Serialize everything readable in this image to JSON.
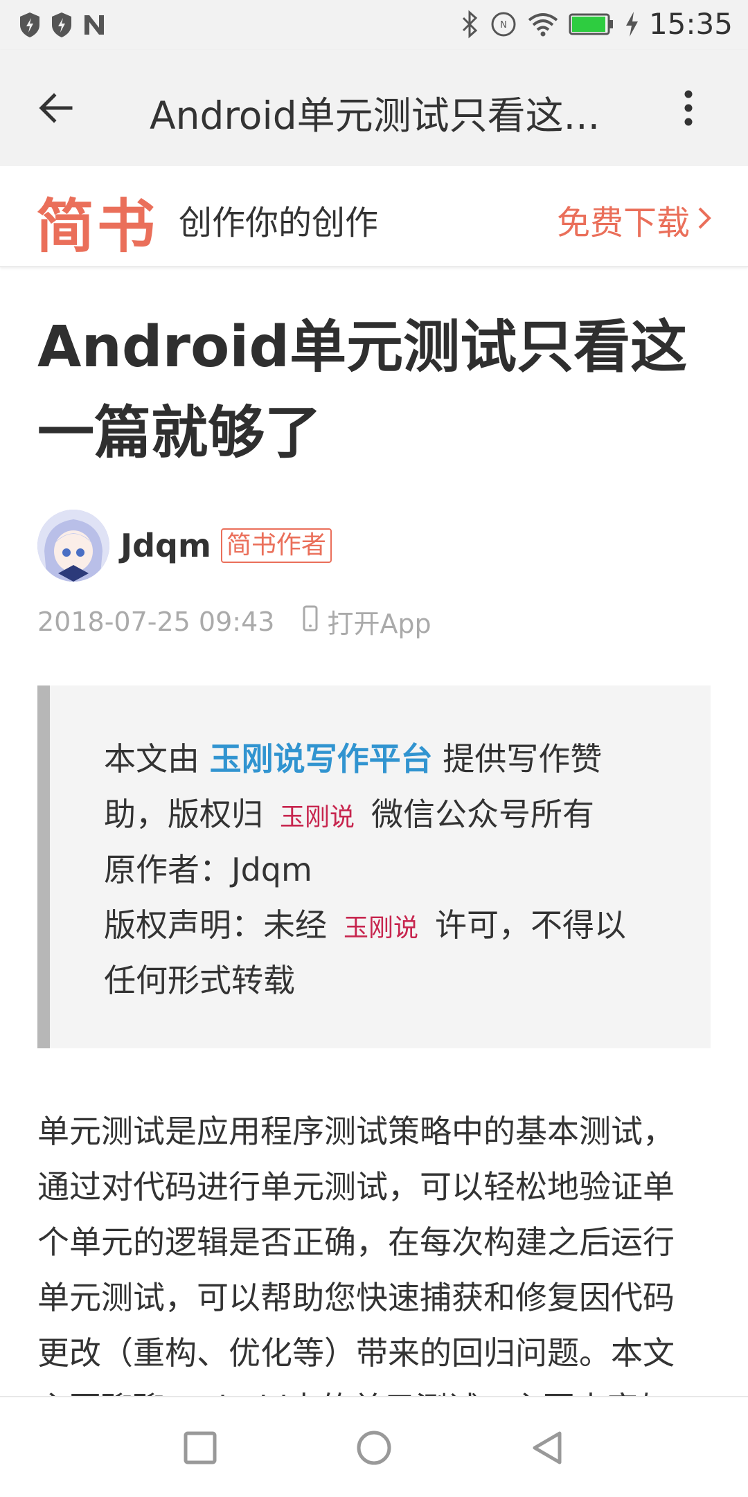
{
  "status_bar": {
    "time": "15:35",
    "left_icons": [
      "shield-icon",
      "shield-icon",
      "n-icon"
    ],
    "right_icons": [
      "bluetooth-icon",
      "nfc-icon",
      "wifi-icon",
      "battery-icon",
      "charging-icon"
    ],
    "battery_level": 0.95
  },
  "app_bar": {
    "title": "Android单元测试只看这..."
  },
  "banner": {
    "logo": "简书",
    "slogan": "创作你的创作",
    "download": "免费下载"
  },
  "article": {
    "title_line1": "Android单元测试只看这",
    "title_line2": "一篇就够了",
    "author": "Jdqm",
    "author_badge": "简书作者",
    "date": "2018-07-25 09:43",
    "open_app": "打开App",
    "quote": {
      "l1_a": "本文由 ",
      "l1_link": "玉刚说写作平台",
      "l1_b": " 提供写作赞",
      "l2_a": "助，版权归",
      "l2_code": "玉刚说",
      "l2_b": "微信公众号所有",
      "l3": "原作者：Jdqm",
      "l4_a": "版权声明：未经",
      "l4_code": "玉刚说",
      "l4_b": "许可，不得以",
      "l5": "任何形式转载"
    },
    "paragraph": [
      "单元测试是应用程序测试策略中的基本测试，",
      "通过对代码进行单元测试，可以轻松地验证单",
      "个单元的逻辑是否正确，在每次构建之后运行",
      "单元测试，可以帮助您快速捕获和修复因代码",
      "更改（重构、优化等）带来的回归问题。本文",
      "主要聊聊Android中的单元测试，主要内容如"
    ]
  },
  "colors": {
    "accent": "#ea6f5a",
    "link": "#3194d0",
    "code": "#c7254e"
  }
}
